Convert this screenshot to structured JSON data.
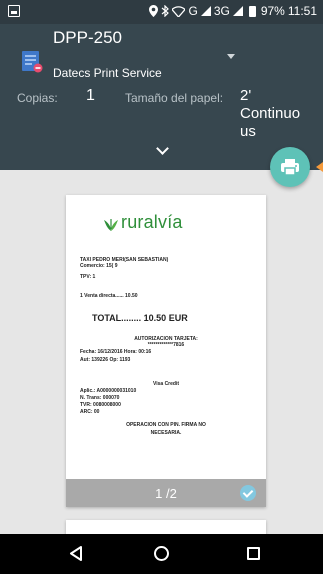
{
  "status_bar": {
    "battery_percent": "97%",
    "time": "11:51",
    "network_1": "G",
    "network_2": "3G",
    "icons": [
      "location-icon",
      "bluetooth-icon",
      "wifi-icon",
      "signal-icon",
      "battery-icon"
    ]
  },
  "header": {
    "printer_name": "DPP-250",
    "printer_service": "Datecs Print Service",
    "copies_label": "Copias:",
    "copies_value": "1",
    "paper_size_label": "Tamaño del papel:",
    "paper_size_value": "2' Continuo us"
  },
  "preview": {
    "logo_text": "ruralvía",
    "receipt_lines": {
      "merchant": "TAXI PEDRO MERI(SAN SEBASTIAN)",
      "comercio": "Comercio: 15(          9",
      "tpv": "TPV: 1",
      "sale": "1 Venta directa......   10.50",
      "total": "TOTAL........   10.50 EUR",
      "auth_title": "AUTORIZACION TARJETA:",
      "card": "*************7816",
      "date_time": "Fecha: 16/12/2016  Hora: 00:16",
      "aut_op": "Aut: 139226          Op: 1193",
      "card_type": "Visa Credit",
      "aplic": "Aplic.: A0000000031010",
      "n_trans": "N. Trans: 000070",
      "tvr": "TVR: 0080008000",
      "arc": "ARC: 00",
      "footer_1": "OPERACION CON PIN. FIRMA NO",
      "footer_2": "NECESARIA."
    },
    "page_counter": "1 /2"
  },
  "colors": {
    "header_bg": "#37474f",
    "fab": "#5ec2b7",
    "logo_green": "#2f8f3a",
    "page_footer": "#a9a9a9"
  }
}
